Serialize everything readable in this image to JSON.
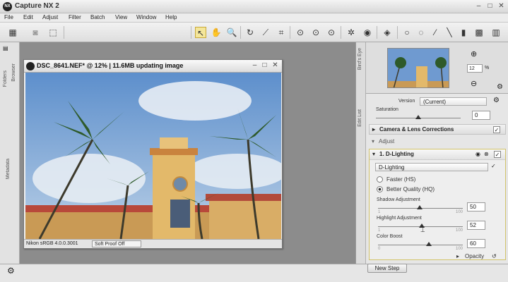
{
  "app": {
    "title": "Capture NX 2",
    "logo": "NX"
  },
  "menu": [
    "File",
    "Edit",
    "Adjust",
    "Filter",
    "Batch",
    "View",
    "Window",
    "Help"
  ],
  "left_tabs": {
    "folders": "Folders",
    "browser": "Browser",
    "metadata": "Metadata"
  },
  "image_window": {
    "title": "DSC_8641.NEF* @ 12% | 11.6MB updating image",
    "profile": "Nikon sRGB 4.0.0.3001",
    "soft_proof": "Soft Proof Off"
  },
  "birds_eye": {
    "tab_label": "Bird's Eye",
    "zoom_value": "12",
    "zoom_unit": "%"
  },
  "edit_list": {
    "tab_label": "Edit List",
    "version_label": "Version",
    "version_value": "(Current)",
    "saturation_label": "Saturation",
    "saturation_value": "0",
    "camera_lens": "Camera & Lens Corrections",
    "adjust_label": "Adjust",
    "dlighting_step": "1. D-Lighting",
    "dlighting_dropdown": "D-Lighting",
    "faster_option": "Faster (HS)",
    "better_option": "Better Quality (HQ)",
    "shadow_label": "Shadow Adjustment",
    "shadow_value": "50",
    "highlight_label": "Highlight Adjustment",
    "highlight_value": "52",
    "color_boost_label": "Color Boost",
    "color_boost_value": "60",
    "tick_min_1": "1",
    "tick_max_1": "100",
    "tick_min_0": "0",
    "tick_max_100": "100",
    "opacity_label": "Opacity",
    "new_step": "New Step"
  },
  "slider_levels": {
    "shadow": 50,
    "highlight": 52,
    "color_boost": 60
  },
  "colors": {
    "toolbar_selected": "#f4e69a",
    "accent_border": "#c8a838",
    "panel_bg": "#e8e8e8"
  }
}
